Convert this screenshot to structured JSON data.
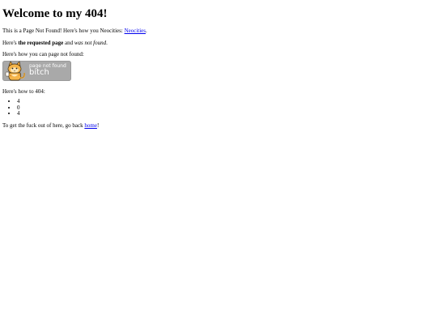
{
  "heading": "Welcome to my 404!",
  "intro": {
    "text": "This is a Page Not Found! Here's how you Neocities: ",
    "link": "Neocities",
    "end": "."
  },
  "requested": {
    "prefix": "Here's ",
    "strong": "the requested page",
    "middle": " and ",
    "em": "was not found",
    "end": "."
  },
  "how_page_not_found": "Here's how you can page not found:",
  "banner": {
    "line1": "page not found",
    "line2": "bitch",
    "mascot_icon": "cat-mascot-icon",
    "background": "#a9a9a9"
  },
  "how_to_404": "Here's how to 404:",
  "list_items": [
    "4",
    "0",
    "4"
  ],
  "footer": {
    "text": "To get the fuck out of here, go back ",
    "link": "home",
    "end": "!"
  },
  "colors": {
    "link": "#0000ee",
    "text": "#000000",
    "background": "#ffffff"
  }
}
